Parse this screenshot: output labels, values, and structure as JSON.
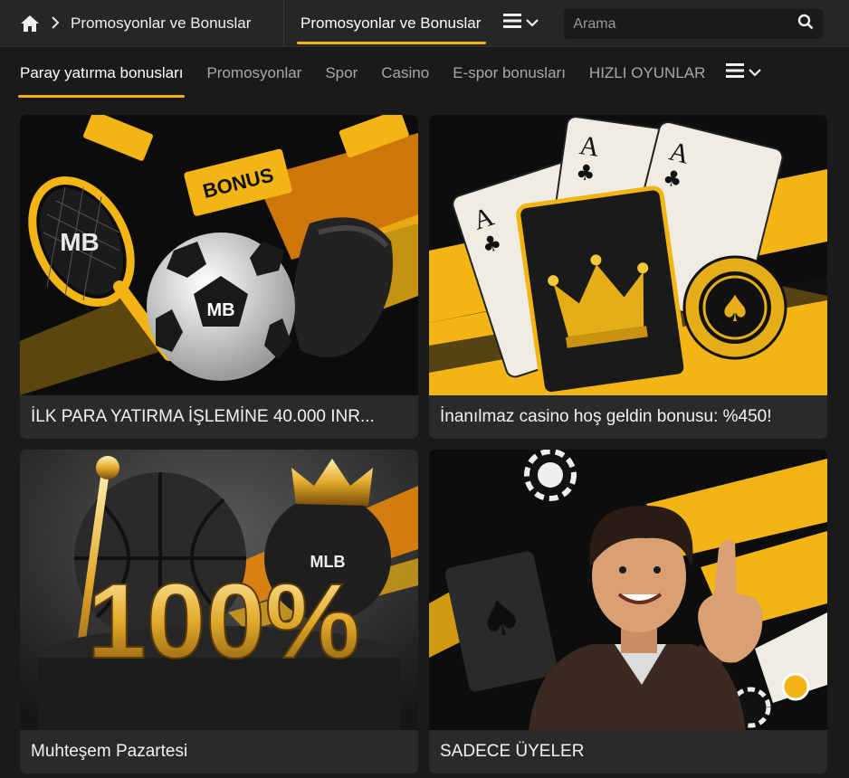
{
  "header": {
    "breadcrumb_label": "Promosyonlar ve Bonuslar",
    "active_tab": "Promosyonlar ve Bonuslar",
    "search_placeholder": "Arama"
  },
  "subnav": {
    "items": [
      {
        "label": "Paray yatırma bonusları",
        "active": true
      },
      {
        "label": "Promosyonlar",
        "active": false
      },
      {
        "label": "Spor",
        "active": false
      },
      {
        "label": "Casino",
        "active": false
      },
      {
        "label": "E-spor bonusları",
        "active": false
      },
      {
        "label": "HIZLI OYUNLAR",
        "active": false
      }
    ]
  },
  "cards": [
    {
      "title": "İLK PARA YATIRMA İŞLEMİNE 40.000 INR...",
      "art": {
        "badge": "BONUS",
        "logo": "MB"
      }
    },
    {
      "title": "İnanılmaz casino hoş geldin bonusu: %450!",
      "art": {
        "card_rank": "A"
      }
    },
    {
      "title": "Muhteşem Pazartesi",
      "art": {
        "big_text": "100%",
        "logo": "MLB"
      }
    },
    {
      "title": "SADECE ÜYELER",
      "art": {}
    }
  ],
  "colors": {
    "accent": "#f3b514",
    "background": "#1a1a1a",
    "bar": "#262626",
    "card": "#2a2a2a"
  },
  "icons": [
    "home-icon",
    "chevron-right-icon",
    "menu-icon",
    "chevron-down-icon",
    "search-icon"
  ]
}
